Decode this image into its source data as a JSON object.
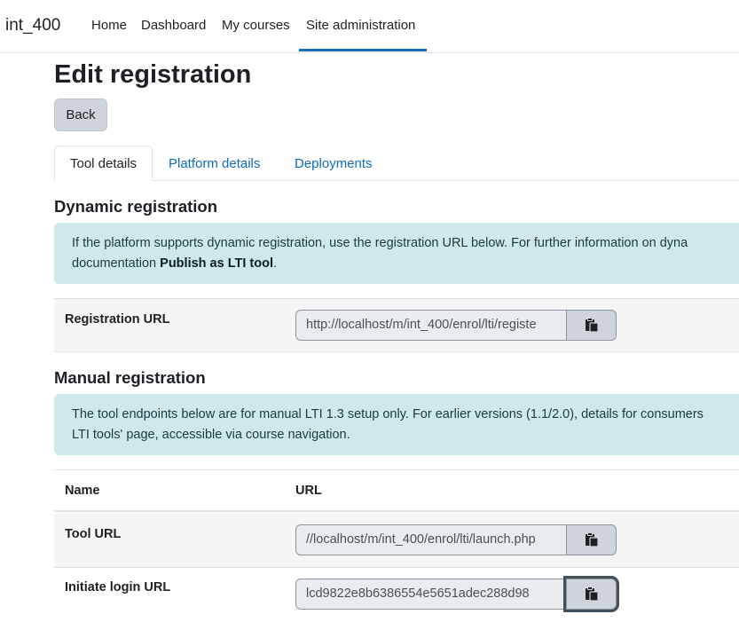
{
  "nav": {
    "brand": "int_400",
    "items": [
      "Home",
      "Dashboard",
      "My courses",
      "Site administration"
    ]
  },
  "page": {
    "title": "Edit registration",
    "back_label": "Back"
  },
  "tabs": [
    {
      "label": "Tool details",
      "active": true
    },
    {
      "label": "Platform details",
      "active": false
    },
    {
      "label": "Deployments",
      "active": false
    }
  ],
  "dynamic": {
    "title": "Dynamic registration",
    "alert_line1": "If the platform supports dynamic registration, use the registration URL below. For further information on dyna",
    "alert_line2_prefix": "documentation ",
    "alert_link": "Publish as LTI tool",
    "alert_line2_suffix": ".",
    "reg_label": "Registration URL",
    "reg_value": "http://localhost/m/int_400/enrol/lti/registe"
  },
  "manual": {
    "title": "Manual registration",
    "alert_line1": "The tool endpoints below are for manual LTI 1.3 setup only. For earlier versions (1.1/2.0), details for consumers",
    "alert_line2": "LTI tools' page, accessible via course navigation.",
    "col_name": "Name",
    "col_url": "URL",
    "rows": [
      {
        "label": "Tool URL",
        "value": "//localhost/m/int_400/enrol/lti/launch.php"
      },
      {
        "label": "Initiate login URL",
        "value": "lcd9822e8b6386554e5651adec288d98"
      }
    ]
  },
  "colors": {
    "link": "#0f6cbf",
    "alert_bg": "#cfe8ea",
    "button_bg": "#ced4da"
  },
  "icons": {
    "copy": "copy-to-clipboard-icon"
  }
}
